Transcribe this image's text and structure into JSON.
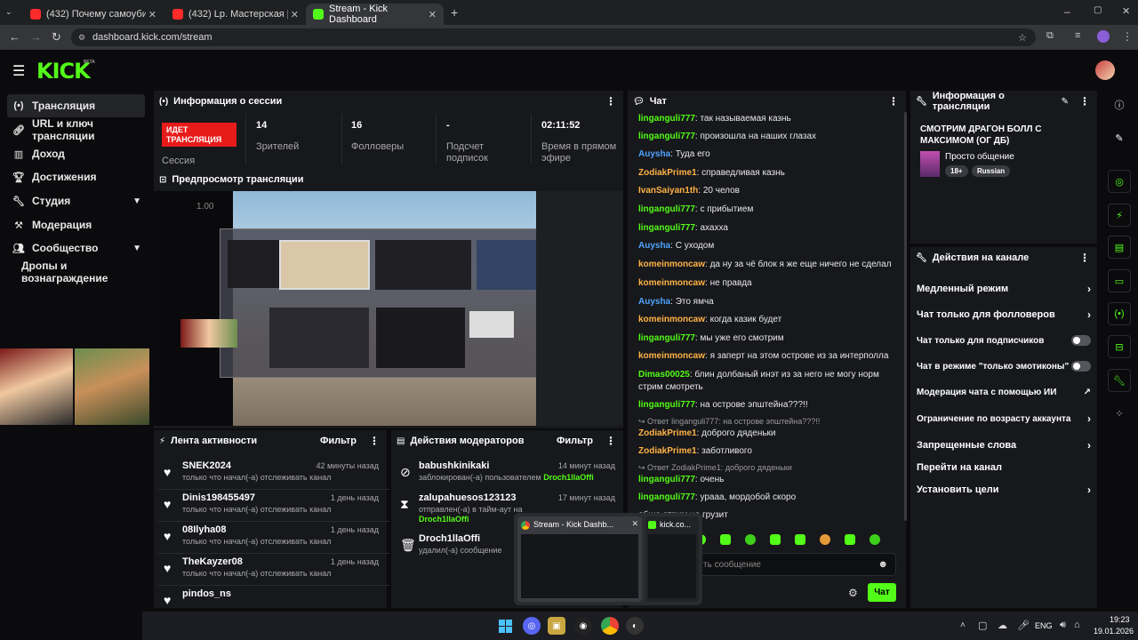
{
  "browser": {
    "tabs": [
      {
        "label": "(432) Почему самоубийцу все",
        "fav_color": "#ff2a2a"
      },
      {
        "label": "(432) Lp. Мастерская [47] • #3",
        "fav_color": "#ff2a2a"
      },
      {
        "label": "Stream - Kick Dashboard",
        "fav_color": "#53fc18"
      }
    ],
    "url": "dashboard.kick.com/stream"
  },
  "kick": {
    "logo": "KICK",
    "beta": "BETA",
    "accent": "#53fc18"
  },
  "sidebar": {
    "items": [
      {
        "label": "Трансляция",
        "icon": "broadcast-icon"
      },
      {
        "label": "URL и ключ трансляции",
        "icon": "link-icon"
      },
      {
        "label": "Доход",
        "icon": "chart-icon"
      },
      {
        "label": "Достижения",
        "icon": "trophy-icon"
      },
      {
        "label": "Студия",
        "icon": "wrench-icon"
      },
      {
        "label": "Модерация",
        "icon": "hammer-icon"
      },
      {
        "label": "Сообщество",
        "icon": "community-icon"
      },
      {
        "label": "Дропы и вознаграждение",
        "icon": ""
      }
    ]
  },
  "session": {
    "title": "Информация о сессии",
    "live_badge": "ИДЕТ ТРАНСЛЯЦИЯ",
    "session_label": "Сессия",
    "stats": [
      {
        "value": "14",
        "label": "Зрителей"
      },
      {
        "value": "16",
        "label": "Фолловеры"
      },
      {
        "value": "-",
        "label": "Подсчет подписок"
      },
      {
        "value": "02:11:52",
        "label": "Время в прямом эфире"
      }
    ]
  },
  "preview": {
    "title": "Предпросмотр трансляции",
    "zoom": "1.00"
  },
  "activity": {
    "title": "Лента активности",
    "filter": "Фильтр",
    "items": [
      {
        "name": "SNEK2024",
        "time": "42 минуты назад",
        "desc": "только что начал(-а) отслеживать канал"
      },
      {
        "name": "Dinis198455497",
        "time": "1 день назад",
        "desc": "только что начал(-а) отслеживать канал"
      },
      {
        "name": "08Ilyha08",
        "time": "1 день назад",
        "desc": "только что начал(-а) отслеживать канал"
      },
      {
        "name": "TheKayzer08",
        "time": "1 день назад",
        "desc": "только что начал(-а) отслеживать канал"
      },
      {
        "name": "pindos_ns",
        "time": "",
        "desc": ""
      }
    ]
  },
  "modactions": {
    "title": "Действия модераторов",
    "filter": "Фильтр",
    "items": [
      {
        "name": "babushkinikaki",
        "time": "14 минут назад",
        "desc": "заблокирован(-а) пользователем",
        "by": "Droch1llaOffi"
      },
      {
        "name": "zalupahuesos123123",
        "time": "17 минут назад",
        "desc": "отправлен(-а) в тайм-аут на",
        "by": "Droch1llaOffi"
      },
      {
        "name": "Droch1llaOffi",
        "time": "",
        "desc": "удалил(-а) сообщение",
        "by": ""
      }
    ]
  },
  "chat": {
    "title": "Чат",
    "placeholder": "ть сообщение",
    "send": "Чат",
    "messages": [
      {
        "user": "linganguli777",
        "color": "#53fc18",
        "text": "так называемая казнь"
      },
      {
        "user": "linganguli777",
        "color": "#53fc18",
        "text": "произошла на наших глазах"
      },
      {
        "user": "Auysha",
        "color": "#4fa3ff",
        "text": "Туда его"
      },
      {
        "user": "ZodiakPrime1",
        "color": "#ffb347",
        "text": "справедливая казнь"
      },
      {
        "user": "IvanSaiyan1th",
        "color": "#ffb347",
        "text": "20 челов"
      },
      {
        "user": "linganguli777",
        "color": "#53fc18",
        "text": "с прибытием"
      },
      {
        "user": "linganguli777",
        "color": "#53fc18",
        "text": "ахахха"
      },
      {
        "user": "Auysha",
        "color": "#4fa3ff",
        "text": "С уходом"
      },
      {
        "user": "komeinmoncaw",
        "color": "#ffb347",
        "text": "да ну за чё блок я же еще ничего не сделал"
      },
      {
        "user": "komeinmoncaw",
        "color": "#ffb347",
        "text": "не правда"
      },
      {
        "user": "Auysha",
        "color": "#4fa3ff",
        "text": "Это ямча"
      },
      {
        "user": "komeinmoncaw",
        "color": "#ffb347",
        "text": "когда казик будет"
      },
      {
        "user": "linganguli777",
        "color": "#53fc18",
        "text": "мы уже его смотрим"
      },
      {
        "user": "komeinmoncaw",
        "color": "#ffb347",
        "text": "я заперт на этом острове из за интерполла"
      },
      {
        "user": "Dimas00025",
        "color": "#53fc18",
        "text": "блин долбаный инэт из за него не могу норм стрим смотреть"
      },
      {
        "user": "linganguli777",
        "color": "#53fc18",
        "text": "на острове эпштейна???!!"
      },
      {
        "reply": "Ответ linganguli777: на острове эпштейна???!!"
      },
      {
        "user": "ZodiakPrime1",
        "color": "#ffb347",
        "text": "доброго дяденьки"
      },
      {
        "user": "ZodiakPrime1",
        "color": "#ffb347",
        "text": "заботливого"
      },
      {
        "reply": "Ответ ZodiakPrime1: доброго дяденьки"
      },
      {
        "user": "linganguli777",
        "color": "#53fc18",
        "text": "очень"
      },
      {
        "user": "linganguli777",
        "color": "#53fc18",
        "text": "урааа, мордобой скоро"
      },
      {
        "user": "",
        "color": "#ffffff",
        "text": "обще стрим не грузит"
      }
    ]
  },
  "stream_info": {
    "title": "Информация о трансляции",
    "stream_title": "СМОТРИМ ДРАГОН БОЛЛ С МАКСИМОМ (ОГ ДБ)",
    "category": "Просто общение",
    "tags": [
      "18+",
      "Russian"
    ]
  },
  "channel_actions": {
    "title": "Действия на канале",
    "items": [
      {
        "label": "Медленный режим",
        "kind": "arrow"
      },
      {
        "label": "Чат только для фолловеров",
        "kind": "arrow"
      },
      {
        "label": "Чат только для подписчиков",
        "kind": "toggle"
      },
      {
        "label": "Чат в режиме \"только эмотиконы\"",
        "kind": "toggle"
      },
      {
        "label": "Модерация чата с помощью ИИ",
        "kind": "external"
      },
      {
        "label": "Ограничение по возрасту аккаунта",
        "kind": "arrow"
      },
      {
        "label": "Запрещенные слова",
        "kind": "arrow"
      },
      {
        "label": "Перейти на канал",
        "kind": "none"
      },
      {
        "label": "Установить цели",
        "kind": "arrow"
      }
    ]
  },
  "taskbar_popup": {
    "title": "Stream - Kick Dashb...",
    "title2": "kick.co..."
  },
  "taskbar": {
    "lang": "ENG",
    "time": "19:23",
    "date": "19.01.2026"
  }
}
